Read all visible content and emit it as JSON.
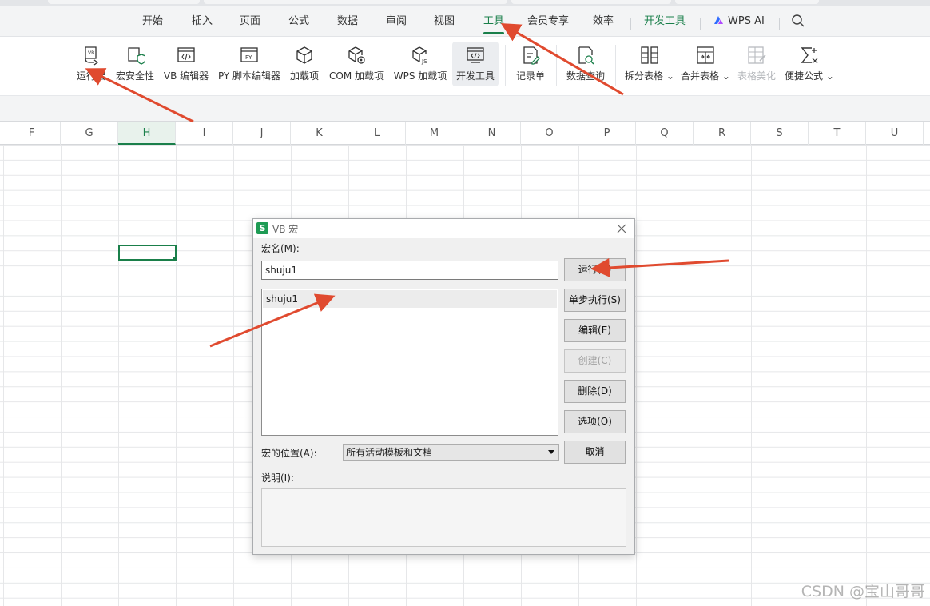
{
  "menu": {
    "items": [
      "开始",
      "插入",
      "页面",
      "公式",
      "数据",
      "审阅",
      "视图",
      "工具",
      "会员专享",
      "效率"
    ],
    "active": "工具",
    "dev_tools": "开发工具",
    "wps_ai": "WPS AI"
  },
  "ribbon": {
    "buttons": {
      "run_macro": "运行宏",
      "macro_security": "宏安全性",
      "vb_editor": "VB 编辑器",
      "py_editor": "PY 脚本编辑器",
      "addins": "加载项",
      "com_addins": "COM 加载项",
      "wps_addins": "WPS 加载项",
      "dev_tools": "开发工具",
      "record_form": "记录单",
      "data_query": "数据查询",
      "split_table": "拆分表格",
      "merge_table": "合并表格",
      "table_beautify": "表格美化",
      "quick_formula": "便捷公式"
    }
  },
  "sheet": {
    "columns": [
      "F",
      "G",
      "H",
      "I",
      "J",
      "K",
      "L",
      "M",
      "N",
      "O",
      "P",
      "Q",
      "R",
      "S",
      "T",
      "U"
    ],
    "selected_column": "H"
  },
  "dialog": {
    "icon_letter": "S",
    "title": "VB 宏",
    "macro_name_label": "宏名(M):",
    "macro_name_value": "shuju1",
    "macros": [
      "shuju1"
    ],
    "buttons": {
      "run": "运行(R)",
      "step": "单步执行(S)",
      "edit": "编辑(E)",
      "create": "创建(C)",
      "delete": "删除(D)",
      "options": "选项(O)",
      "cancel": "取消"
    },
    "location_label": "宏的位置(A):",
    "location_value": "所有活动模板和文档",
    "description_label": "说明(I):"
  },
  "watermark": "CSDN @宝山哥哥",
  "colors": {
    "accent": "#1a7f4a",
    "annotation_arrow": "#e04a2f"
  }
}
